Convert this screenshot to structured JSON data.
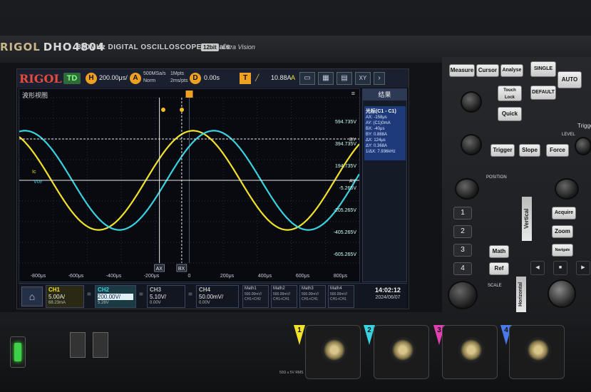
{
  "brand": {
    "maker": "RIGOL",
    "model": "DHO4804",
    "desc": "800MHz  DIGITAL OSCILLOSCOPE  4GSa/s",
    "bits": "12bit",
    "ultra": "Ultra Vision"
  },
  "topbar": {
    "logo": "RIGOL",
    "mode": "TD",
    "horiz_badge": "H",
    "horiz_scale": "200.00μs/",
    "acq_badge": "A",
    "acq_rate": "500MSa/s",
    "acq_mode": "Norm",
    "acq_points": "1Mpts",
    "acq_time": "2ms/pts",
    "delay_badge": "D",
    "delay_value": "0.00s",
    "trig_badge": "T",
    "trig_level": "10.88A",
    "trig_ch": "A",
    "tools": [
      "▭",
      "▦",
      "▤",
      "XY",
      "›"
    ]
  },
  "waveview": {
    "title": "波形视图",
    "menu": "≡"
  },
  "chart_data": {
    "type": "line",
    "xlabel": "",
    "ylabel": "",
    "x_ticks": [
      "-800μs",
      "-600μs",
      "-400μs",
      "-200μs",
      "0",
      "200μs",
      "400μs",
      "600μs",
      "800μs"
    ],
    "y_ticks": [
      "594.735V",
      "394.735V",
      "194.735V",
      "-5.265V",
      "-205.265V",
      "-405.265V",
      "-605.265V"
    ],
    "xlim": [
      -900,
      900
    ],
    "ylim": [
      -4,
      4
    ],
    "series": [
      {
        "name": "Ic",
        "color": "#f2e12a",
        "period_us": 1000,
        "amplitude": 2.4,
        "phase_us": 0
      },
      {
        "name": "Vce",
        "color": "#38d2e0",
        "period_us": 1000,
        "amplitude": 2.4,
        "phase_us": 110
      }
    ],
    "labels": {
      "ic": "Ic",
      "vce": "Vce",
      "ay": "AY",
      "by": "BY",
      "ax": "AX",
      "bx": "BX"
    }
  },
  "results": {
    "title": "结果",
    "header": "光标(C1 - C1)",
    "rows": [
      "AX:    -158μs",
      "AY:   (C1)0mA",
      "BX:    -40μs",
      "BY:   0.888A",
      "ΔX:    124μs",
      "ΔY:   0.368A",
      "1/ΔX:  7.936kHz"
    ]
  },
  "channels": [
    {
      "name": "CH1",
      "value": "5.00A/",
      "sub": "68.23mA",
      "color": "#f2e12a"
    },
    {
      "name": "CH2",
      "value": "200.00V/",
      "sub": "5.26V",
      "color": "#38d2e0"
    },
    {
      "name": "CH3",
      "value": "5.10V/",
      "sub": "0.00V",
      "color": "#e040b0"
    },
    {
      "name": "CH4",
      "value": "50.00mV/",
      "sub": "0.00V",
      "color": "#4a7ae8"
    }
  ],
  "eq": "=",
  "maths": [
    {
      "name": "Math1",
      "v": "500.00mV/",
      "sub": "CH1×CH2"
    },
    {
      "name": "Math2",
      "v": "500.00mV/",
      "sub": "CH1+CH1"
    },
    {
      "name": "Math3",
      "v": "500.00mV/",
      "sub": "CH1+CH1"
    },
    {
      "name": "Math4",
      "v": "500.00mV/",
      "sub": "CH1+CH1"
    }
  ],
  "clock": {
    "time": "14:02:12",
    "date": "2024/06/07"
  },
  "panel": {
    "measure": "Measure",
    "cursor": "Cursor",
    "analyse": "Analyse",
    "single": "SINGLE",
    "auto": "AUTO",
    "default": "DEFAULT",
    "touch_lock": "Touch Lock",
    "quick": "Quick",
    "trigger_group": "Trigger",
    "trigger": "Trigger",
    "slope": "Slope",
    "force": "Force",
    "level": "LEVEL",
    "vertical": "Vertical",
    "horizontal": "Horizontal",
    "acquire": "Acquire",
    "zoom": "Zoom",
    "navigate": "Navigate",
    "math": "Math",
    "ref": "Ref",
    "position": "POSITION",
    "scale": "SCALE",
    "ch_buttons": [
      "1",
      "2",
      "3",
      "4"
    ]
  },
  "front": {
    "jack_labels": [
      "1",
      "2",
      "3",
      "4"
    ],
    "spec": "50Ω ≤ 5V RMS",
    "jack_colors": [
      "#f2e12a",
      "#38d2e0",
      "#e040b0",
      "#4a7ae8"
    ]
  }
}
